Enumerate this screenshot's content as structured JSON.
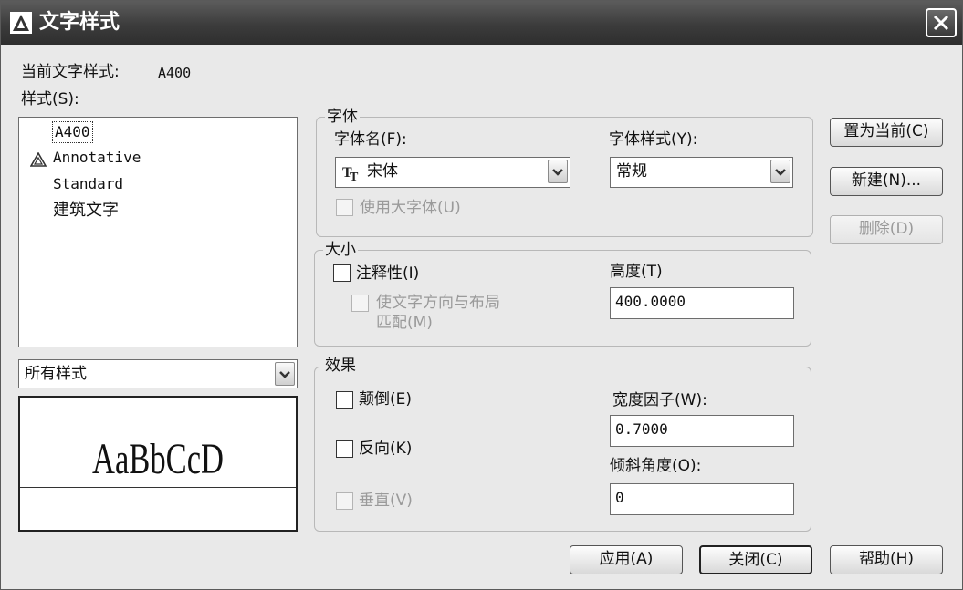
{
  "window": {
    "title": "文字样式"
  },
  "current_style": {
    "label": "当前文字样式:",
    "value": "A400"
  },
  "styles_label": "样式(S):",
  "styles": [
    {
      "name": "A400",
      "selected": true,
      "annotative": false
    },
    {
      "name": "Annotative",
      "selected": false,
      "annotative": true
    },
    {
      "name": "Standard",
      "selected": false,
      "annotative": false
    },
    {
      "name": "建筑文字",
      "selected": false,
      "annotative": false
    }
  ],
  "filter": {
    "value": "所有样式"
  },
  "preview": {
    "text": "AaBbCcD"
  },
  "font": {
    "group_title": "字体",
    "name_label": "字体名(F):",
    "name_value": "宋体",
    "name_icon": "truetype-icon",
    "style_label": "字体样式(Y):",
    "style_value": "常规",
    "bigfont_label": "使用大字体(U)",
    "bigfont_checked": false,
    "bigfont_enabled": false
  },
  "size": {
    "group_title": "大小",
    "annotative_label": "注释性(I)",
    "annotative_checked": false,
    "match_label_line1": "使文字方向与布局",
    "match_label_line2": "匹配(M)",
    "match_enabled": false,
    "height_label": "高度(T)",
    "height_value": "400.0000"
  },
  "effects": {
    "group_title": "效果",
    "upside_down_label": "颠倒(E)",
    "upside_down_checked": false,
    "backwards_label": "反向(K)",
    "backwards_checked": false,
    "vertical_label": "垂直(V)",
    "vertical_enabled": false,
    "width_factor_label": "宽度因子(W):",
    "width_factor_value": "0.7000",
    "oblique_label": "倾斜角度(O):",
    "oblique_value": "0"
  },
  "buttons": {
    "set_current": "置为当前(C)",
    "new": "新建(N)...",
    "delete": "删除(D)",
    "apply": "应用(A)",
    "close": "关闭(C)",
    "help": "帮助(H)"
  },
  "colors": {
    "titlebar": "#3c3c3c",
    "dialog_bg": "#e9e9e9",
    "disabled_text": "#9a9a9a"
  }
}
